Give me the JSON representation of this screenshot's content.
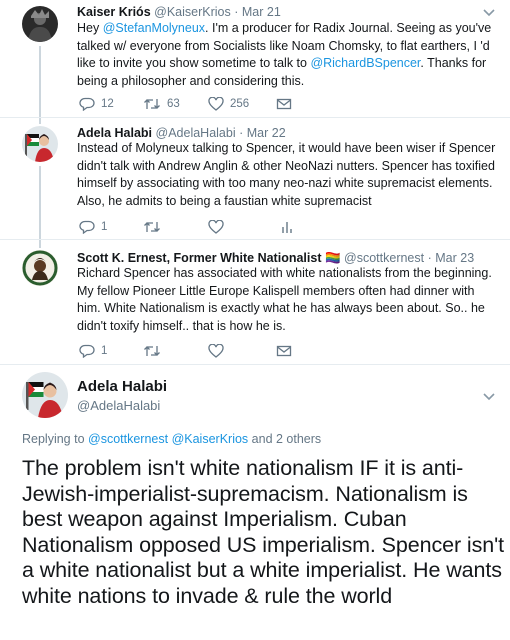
{
  "tweets": [
    {
      "name": "Kaiser Kriós",
      "handle": "@KaiserKrios",
      "time": "Mar 21",
      "text_parts": [
        "Hey ",
        "@StefanMolyneux",
        ". I'm a producer for Radix Journal. Seeing as you've talked w/ everyone from Socialists like Noam Chomsky, to flat earthers, I 'd like to invite you show sometime to talk to ",
        "@RichardBSpencer",
        ". Thanks for being a philosopher and considering this."
      ],
      "replies": "12",
      "retweets": "63",
      "likes": "256"
    },
    {
      "name": "Adela Halabi",
      "handle": "@AdelaHalabi",
      "time": "Mar 22",
      "text": "Instead of Molyneux talking to Spencer, it would have been wiser if Spencer didn't talk with Andrew Anglin & other NeoNazi nutters. Spencer has toxified himself by associating with too many neo-nazi white supremacist elements. Also, he admits to being a faustian white supremacist",
      "replies": "1"
    },
    {
      "name": "Scott K. Ernest, Former White Nationalist",
      "name_emoji": "🏳️‍🌈",
      "handle": "@scottkernest",
      "time": "Mar 23",
      "text": "Richard Spencer has associated with white nationalists from the beginning. My fellow Pioneer Little Europe Kalispell members often had dinner with him. White Nationalism is exactly what he has always been about. So.. he didn't toxify himself.. that is how he is.",
      "replies": "1"
    }
  ],
  "main": {
    "name": "Adela Halabi",
    "handle": "@AdelaHalabi",
    "replying_prefix": "Replying to ",
    "replying_user1": "@scottkernest",
    "replying_user2": "@KaiserKrios",
    "replying_suffix": " and 2 others",
    "text": "The problem isn't white nationalism IF it is anti-Jewish-imperialist-supremacism. Nationalism is best weapon against Imperialism. Cuban Nationalism opposed US imperialism. Spencer isn't a white nationalist but a white imperialist. He wants white nations to invade & rule the world"
  },
  "sep": "·",
  "colors": {
    "link": "#1b95e0",
    "muted": "#657786",
    "line": "#ccd6dd"
  }
}
